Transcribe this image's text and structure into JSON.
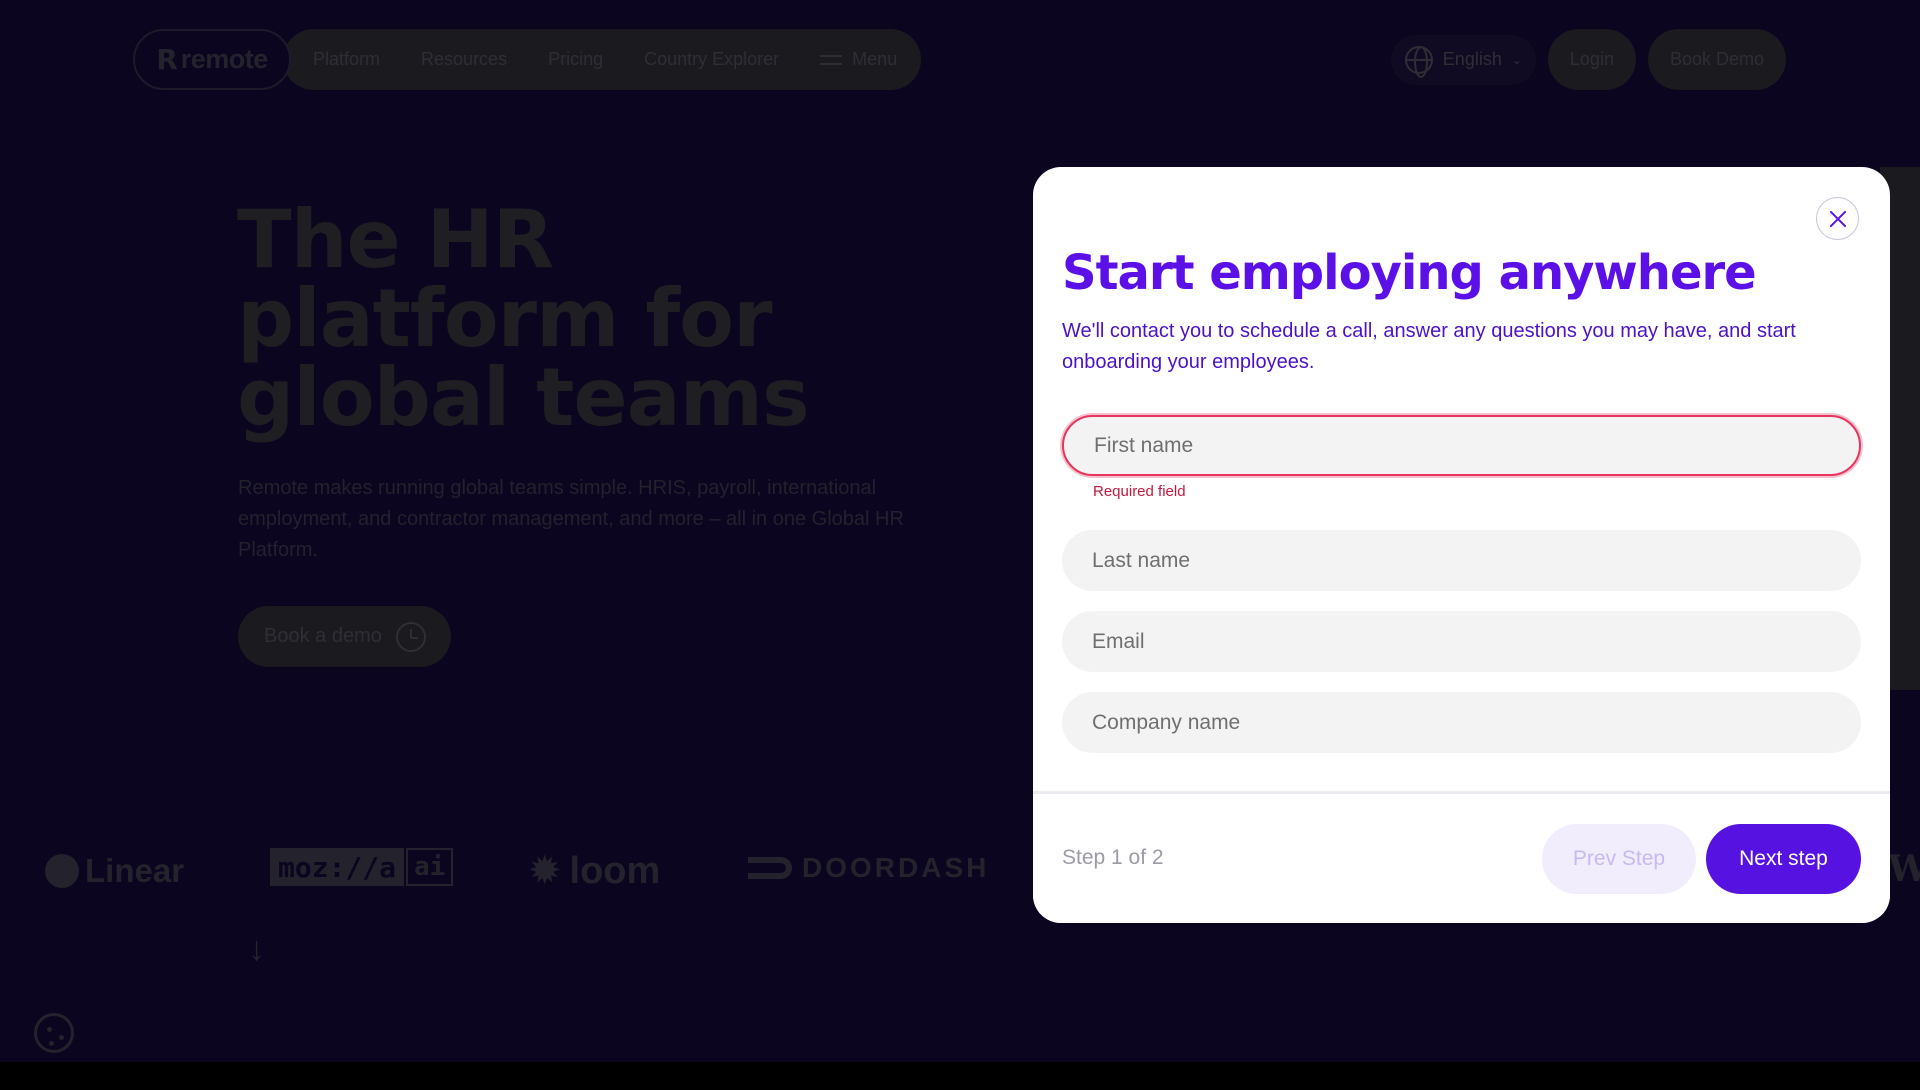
{
  "colors": {
    "backdrop": "#0b0520",
    "accent": "#5512e0",
    "title": "#5c10e8",
    "error": "#c2183e",
    "modal_bg": "#ffffff"
  },
  "nav": {
    "logo_mark": "R",
    "logo_text": "remote",
    "links": [
      "Platform",
      "Resources",
      "Pricing",
      "Country Explorer"
    ],
    "menu_label": "Menu",
    "language": "English",
    "login": "Login",
    "book_demo": "Book Demo"
  },
  "hero": {
    "title": "The HR platform for global teams",
    "subtitle": "Remote makes running global teams simple. HRIS, payroll, international employment, and contractor management, and more – all in one Global HR Platform.",
    "cta": "Book a demo"
  },
  "logos": {
    "linear": "Linear",
    "mozilla": "moz://a",
    "mozilla_ai": "ai",
    "loom": "loom",
    "doordash": "DOORDASH",
    "partial": "W"
  },
  "icons": {
    "close": "close-icon",
    "globe": "globe-icon",
    "chevron": "chevron-down-icon",
    "clock": "clock-icon",
    "hamburger": "hamburger-icon",
    "cookie": "cookie-icon",
    "arrow_down": "arrow-down-icon"
  },
  "modal": {
    "title": "Start employing anywhere",
    "description": "We'll contact you to schedule a call, answer any questions you may have, and start onboarding your employees.",
    "fields": {
      "first_name": {
        "placeholder": "First name",
        "value": "",
        "error": "Required field"
      },
      "last_name": {
        "placeholder": "Last name",
        "value": ""
      },
      "email": {
        "placeholder": "Email",
        "value": ""
      },
      "company": {
        "placeholder": "Company name",
        "value": ""
      }
    },
    "step": "Step 1 of 2",
    "prev_label": "Prev Step",
    "next_label": "Next step"
  }
}
